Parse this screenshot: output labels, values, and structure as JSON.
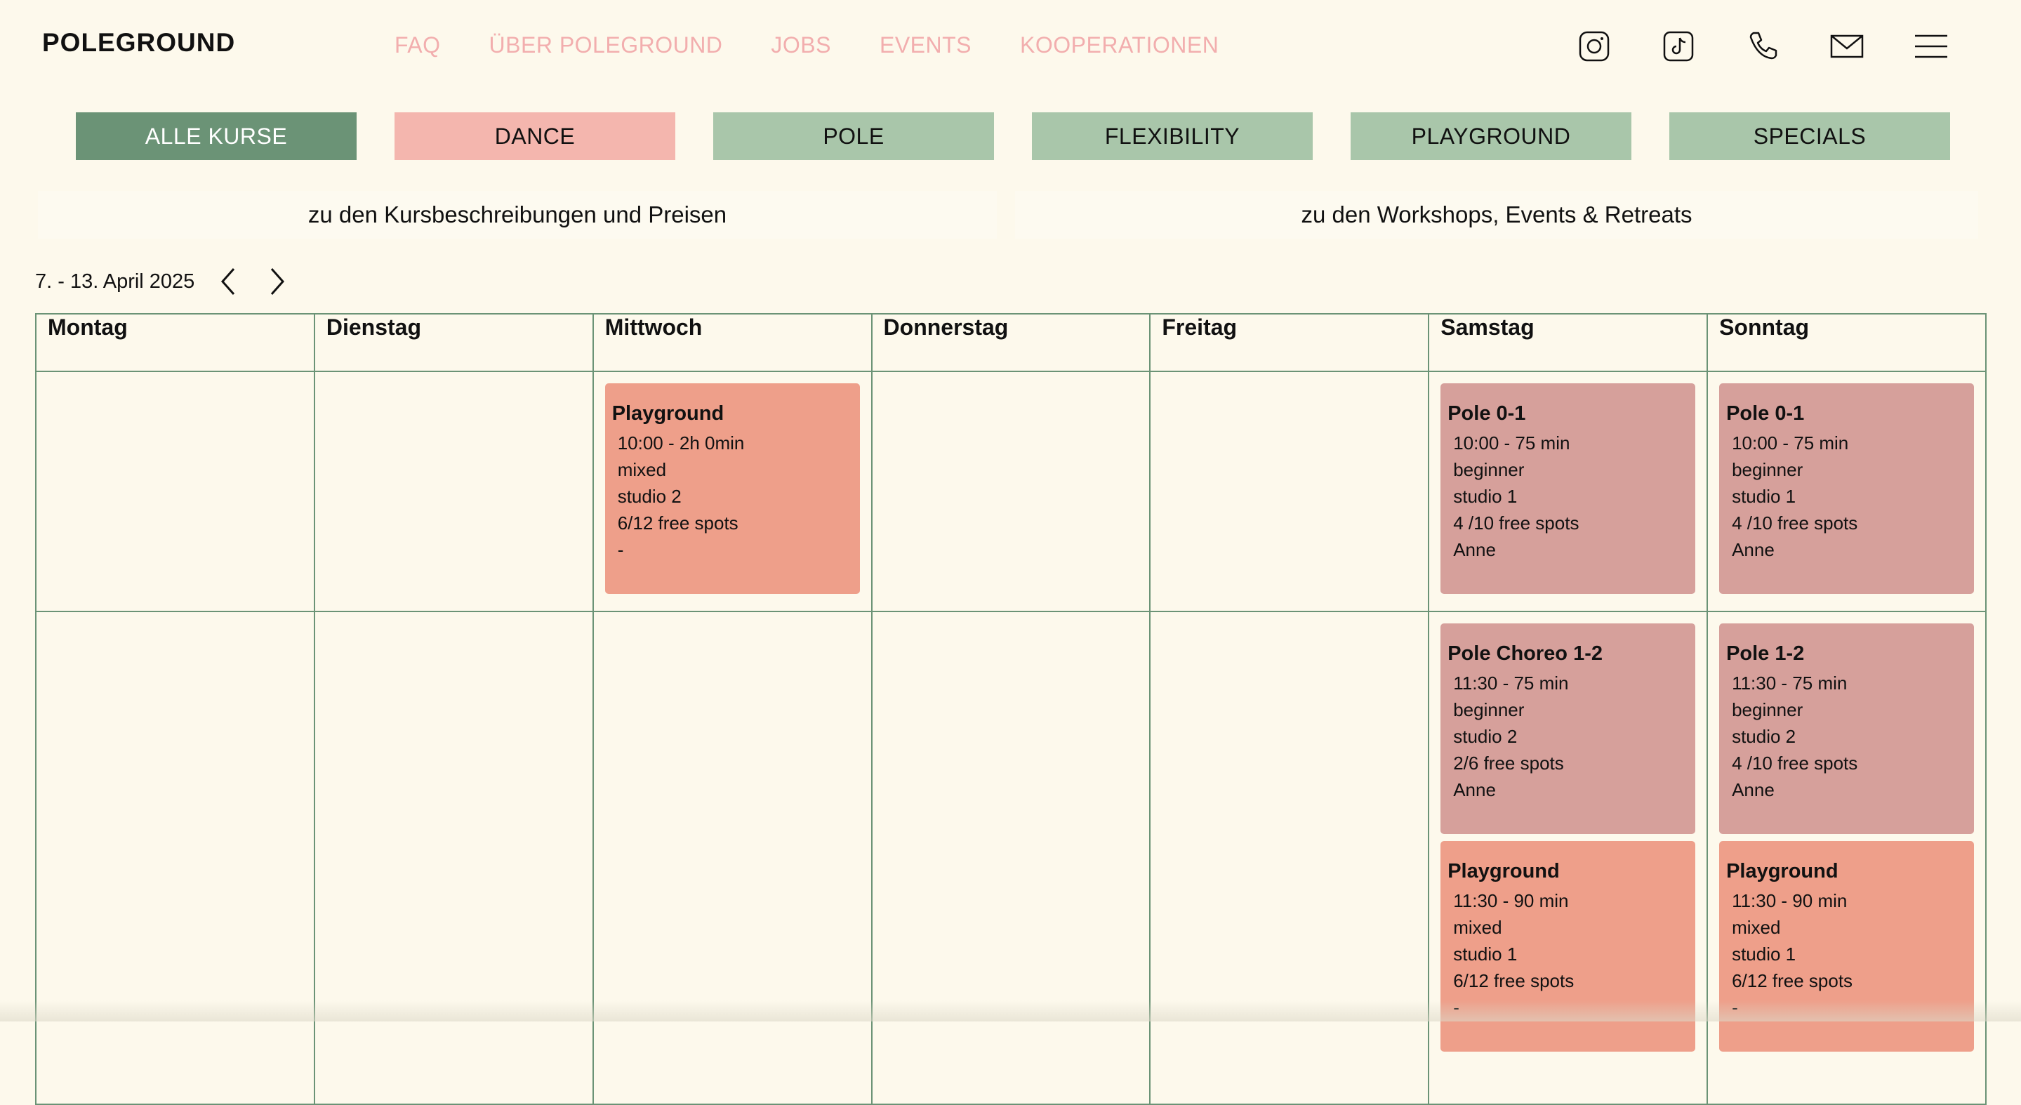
{
  "header": {
    "logo": "POLEGROUND",
    "nav": [
      "FAQ",
      "ÜBER POLEGROUND",
      "JOBS",
      "EVENTS",
      "KOOPERATIONEN"
    ],
    "icons": [
      "instagram-icon",
      "tiktok-icon",
      "phone-icon",
      "mail-icon",
      "menu-icon"
    ]
  },
  "filters": [
    "ALLE KURSE",
    "DANCE",
    "POLE",
    "FLEXIBILITY",
    "PLAYGROUND",
    "SPECIALS"
  ],
  "links": {
    "courses": "zu den Kursbeschreibungen und Preisen",
    "workshops": "zu den Workshops, Events & Retreats"
  },
  "week": {
    "label": "7. - 13. April 2025"
  },
  "days": [
    "Montag",
    "Dienstag",
    "Mittwoch",
    "Donnerstag",
    "Freitag",
    "Samstag",
    "Sonntag"
  ],
  "slots": {
    "wed_1000": {
      "title": "Playground",
      "time": "10:00  -  2h 0min",
      "level": "mixed",
      "room": "studio 2",
      "spots": "6/12 free spots",
      "trainer": "-"
    },
    "sat_1000": {
      "title": "Pole 0-1",
      "time": "10:00  -  75 min",
      "level": "beginner",
      "room": "studio 1",
      "spots": "4 /10 free spots",
      "trainer": "Anne"
    },
    "sun_1000": {
      "title": "Pole 0-1",
      "time": "10:00  -  75 min",
      "level": "beginner",
      "room": "studio 1",
      "spots": "4 /10 free spots",
      "trainer": "Anne"
    },
    "sat_1130a": {
      "title": "Pole Choreo 1-2",
      "time": "11:30  -  75 min",
      "level": "beginner",
      "room": "studio 2",
      "spots": "2/6 free spots",
      "trainer": "Anne"
    },
    "sun_1130a": {
      "title": "Pole 1-2",
      "time": "11:30  -  75 min",
      "level": "beginner",
      "room": "studio 2",
      "spots": "4 /10 free spots",
      "trainer": "Anne"
    },
    "sat_1130b": {
      "title": "Playground",
      "time": "11:30  -  90 min",
      "level": "mixed",
      "room": "studio 1",
      "spots": "6/12 free spots",
      "trainer": "-"
    },
    "sun_1130b": {
      "title": "Playground",
      "time": "11:30  -  90 min",
      "level": "mixed",
      "room": "studio 1",
      "spots": "6/12 free spots",
      "trainer": "-"
    }
  },
  "colors": {
    "background": "#fdf9ec",
    "accent_green": "#6b9376",
    "pole_card": "#d6a09b",
    "playground_card": "#ee9f8a",
    "nav_pink": "#f2aeae"
  }
}
